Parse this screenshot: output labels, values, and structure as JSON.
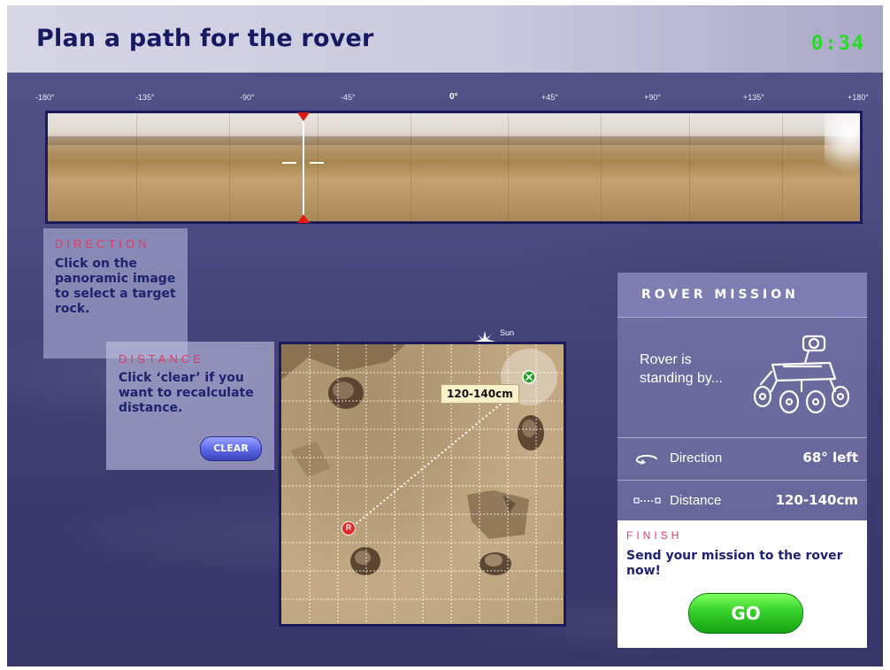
{
  "title": "Plan a path for the rover",
  "timer": "0:34",
  "panorama": {
    "ticks": [
      "-180°",
      "-135°",
      "-90°",
      "-45°",
      "0°",
      "+45°",
      "+90°",
      "+135°",
      "+180°"
    ]
  },
  "direction_panel": {
    "heading": "DIRECTION",
    "text": "Click on the panoramic image to select a target rock."
  },
  "distance_panel": {
    "heading": "DISTANCE",
    "text": "Click ‘clear’ if you want to recalculate distance.",
    "clear_label": "CLEAR"
  },
  "map": {
    "sun_label": "Sun",
    "distance_label": "120-140cm",
    "rover_marker": "R"
  },
  "mission": {
    "title": "ROVER MISSION",
    "status": "Rover is standing by...",
    "direction_label": "Direction",
    "direction_value": "68° left",
    "distance_label": "Distance",
    "distance_value": "120-140cm"
  },
  "finish": {
    "heading": "FINISH",
    "text": "Send your mission to the rover now!",
    "go_label": "GO"
  },
  "colors": {
    "title": "#161a62",
    "timer": "#22dd22",
    "accent_pink": "#e03a66",
    "go_green": "#34d12a",
    "marker_red": "#e01818"
  }
}
